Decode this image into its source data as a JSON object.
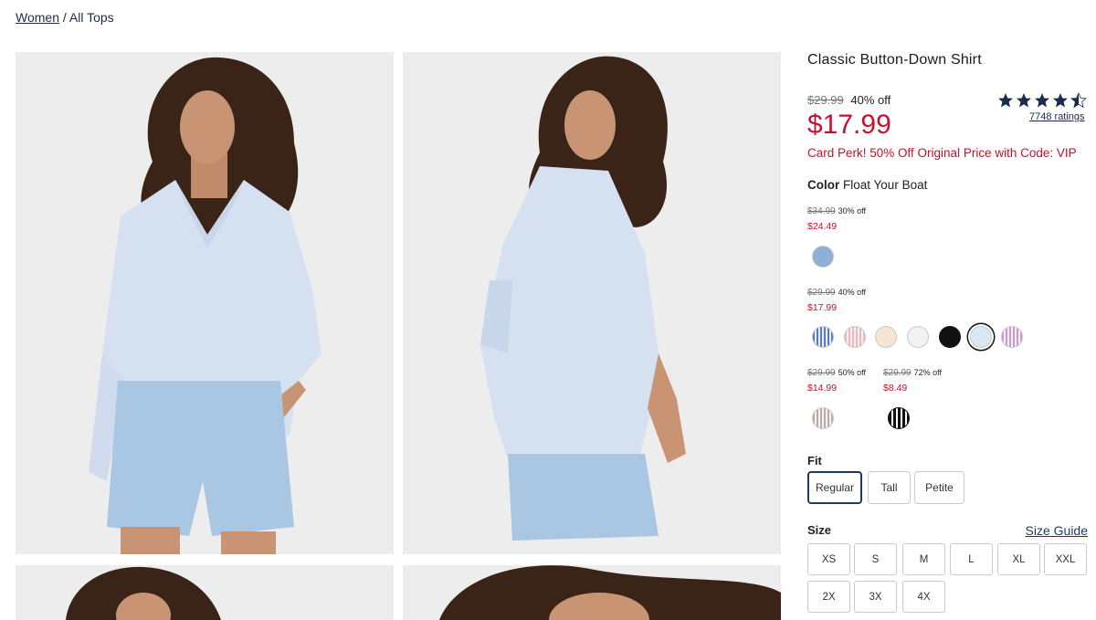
{
  "breadcrumb": {
    "parent": "Women",
    "separator": "/",
    "current": "All Tops"
  },
  "product": {
    "title": "Classic Button-Down Shirt",
    "original_price": "$29.99",
    "discount": "40% off",
    "price": "$17.99",
    "rating_stars": 4.5,
    "ratings_count": "7748 ratings",
    "card_perk": "Card Perk! 50% Off Original Price with Code: VIP"
  },
  "color": {
    "label": "Color",
    "selected_name": "Float Your Boat",
    "tiers": [
      {
        "old": "$34.99",
        "pct": "30% off",
        "sale": "$24.49"
      },
      {
        "old": "$29.99",
        "pct": "40% off",
        "sale": "$17.99"
      },
      {
        "old": "$29.99",
        "pct": "50% off",
        "sale": "$14.99"
      },
      {
        "old": "$29.99",
        "pct": "72% off",
        "sale": "$8.49"
      }
    ],
    "swatch_colors": {
      "chambray": "#8fb0d4",
      "blue_stripe": "#5a78c8",
      "pink_stripe": "#e9b9be",
      "cream": "#f4e6d2",
      "white": "#f2f2f2",
      "black": "#111111",
      "light_blue": "#dbe7f3",
      "lilac_stripe": "#c79ac9",
      "neutral_stripe": "#b8aaa6",
      "black_stripe": "#111111"
    }
  },
  "fit": {
    "label": "Fit",
    "options": [
      "Regular",
      "Tall",
      "Petite"
    ],
    "selected": "Regular"
  },
  "size": {
    "label": "Size",
    "guide_label": "Size Guide",
    "options": [
      "XS",
      "S",
      "M",
      "L",
      "XL",
      "XXL",
      "2X",
      "3X",
      "4X"
    ]
  },
  "colors": {
    "accent_red": "#c8102e",
    "navy": "#1f2a44",
    "star": "#1c2b4a"
  }
}
